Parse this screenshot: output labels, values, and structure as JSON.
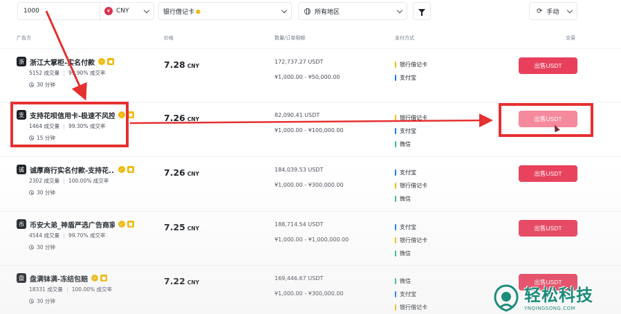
{
  "filters": {
    "amount_value": "1000",
    "currency_badge": "¥",
    "currency": "CNY",
    "payment_method": "银行借记卡",
    "region": "所有地区",
    "refresh_mode": "手动"
  },
  "table_headers": {
    "advertiser": "广告方",
    "price": "价格",
    "quantity_limits": "数量/订单限额",
    "payment": "支付方式",
    "trade": "交易"
  },
  "labels": {
    "volume_suffix": "成交量",
    "rate_suffix": "成交率",
    "sell_button": "出售USDT"
  },
  "rows": [
    {
      "avatar": "浙",
      "name": "浙江大掌柜-实名付款",
      "volume": "5152 成交量",
      "rate": "99.90% 成交率",
      "time": "30 分钟",
      "price": "7.28",
      "price_unit": "CNY",
      "available": "172,737.27 USDT",
      "range": "¥1,000.00 - ¥50,000.00",
      "payments": [
        {
          "name": "银行借记卡",
          "color": "#f0b90b"
        },
        {
          "name": "支付宝",
          "color": "#1677ff"
        }
      ],
      "sell": "出售USDT"
    },
    {
      "avatar": "支",
      "name": "支持花呗信用卡-极速不风控",
      "volume": "1464 成交量",
      "rate": "99.30% 成交率",
      "time": "15 分钟",
      "price": "7.26",
      "price_unit": "CNY",
      "available": "82,090.41 USDT",
      "range": "¥1,000.00 - ¥100,000.00",
      "payments": [
        {
          "name": "银行借记卡",
          "color": "#f0b90b"
        },
        {
          "name": "支付宝",
          "color": "#1677ff"
        },
        {
          "name": "微信",
          "color": "#2ebd85"
        }
      ],
      "sell": "出售USDT"
    },
    {
      "avatar": "诚",
      "name": "诚厚商行实名付款-支持花...",
      "volume": "2302 成交量",
      "rate": "100.00% 成交率",
      "time": "30 分钟",
      "price": "7.26",
      "price_unit": "CNY",
      "available": "184,039.53 USDT",
      "range": "¥1,000.00 - ¥300,000.00",
      "payments": [
        {
          "name": "支付宝",
          "color": "#1677ff"
        },
        {
          "name": "银行借记卡",
          "color": "#f0b90b"
        },
        {
          "name": "微信",
          "color": "#2ebd85"
        }
      ],
      "sell": "出售USDT"
    },
    {
      "avatar": "币",
      "name": "币安大弟_神盾严选广告商家",
      "volume": "4544 成交量",
      "rate": "99.70% 成交率",
      "time": "30 分钟",
      "price": "7.25",
      "price_unit": "CNY",
      "available": "188,714.54 USDT",
      "range": "¥1,000.00 - ¥1,000,000.00",
      "payments": [
        {
          "name": "支付宝",
          "color": "#1677ff"
        },
        {
          "name": "银行借记卡",
          "color": "#f0b90b"
        },
        {
          "name": "微信",
          "color": "#2ebd85"
        }
      ],
      "sell": "出售USDT"
    },
    {
      "avatar": "盘",
      "name": "盘满钵满-冻结包赔",
      "volume": "18331 成交量",
      "rate": "100.00% 成交率",
      "time": "30 分钟",
      "price": "7.22",
      "price_unit": "CNY",
      "available": "169,446.67 USDT",
      "range": "¥1,000.00 - ¥300,000.00",
      "payments": [
        {
          "name": "微信",
          "color": "#2ebd85"
        },
        {
          "name": "支付宝",
          "color": "#1677ff"
        },
        {
          "name": "银行借记卡",
          "color": "#f0b90b"
        }
      ],
      "sell": "出售USDT"
    }
  ],
  "annotation_color": "#e53030",
  "watermark": {
    "title": "轻松科技",
    "subtitle": "YNQINGSONG.COM",
    "color": "#1c8b79"
  }
}
